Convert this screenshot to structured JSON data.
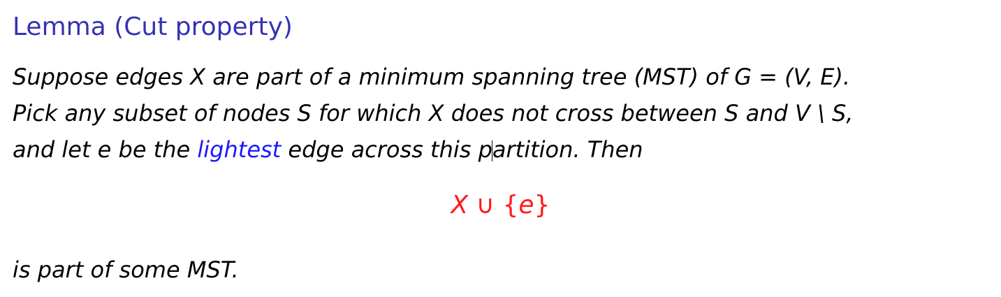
{
  "title": "Lemma (Cut property)",
  "body": {
    "line1": "Suppose edges X are part of a minimum spanning tree (MST) of G = (V, E).",
    "line2": "Pick any subset of nodes S for which X does not cross between S and V \\ S,",
    "line3_before": "and let e be the ",
    "line3_highlight": "lightest",
    "line3_mid": " edge across this p",
    "line3_after": "artition. Then"
  },
  "display_math": {
    "left": "X",
    "union": "∪",
    "open": "{",
    "elem": "e",
    "close": "}"
  },
  "conclusion": "is part of some MST.",
  "colors": {
    "title": "#3333b3",
    "highlight": "#1a1aff",
    "math": "#ff1a1a"
  }
}
